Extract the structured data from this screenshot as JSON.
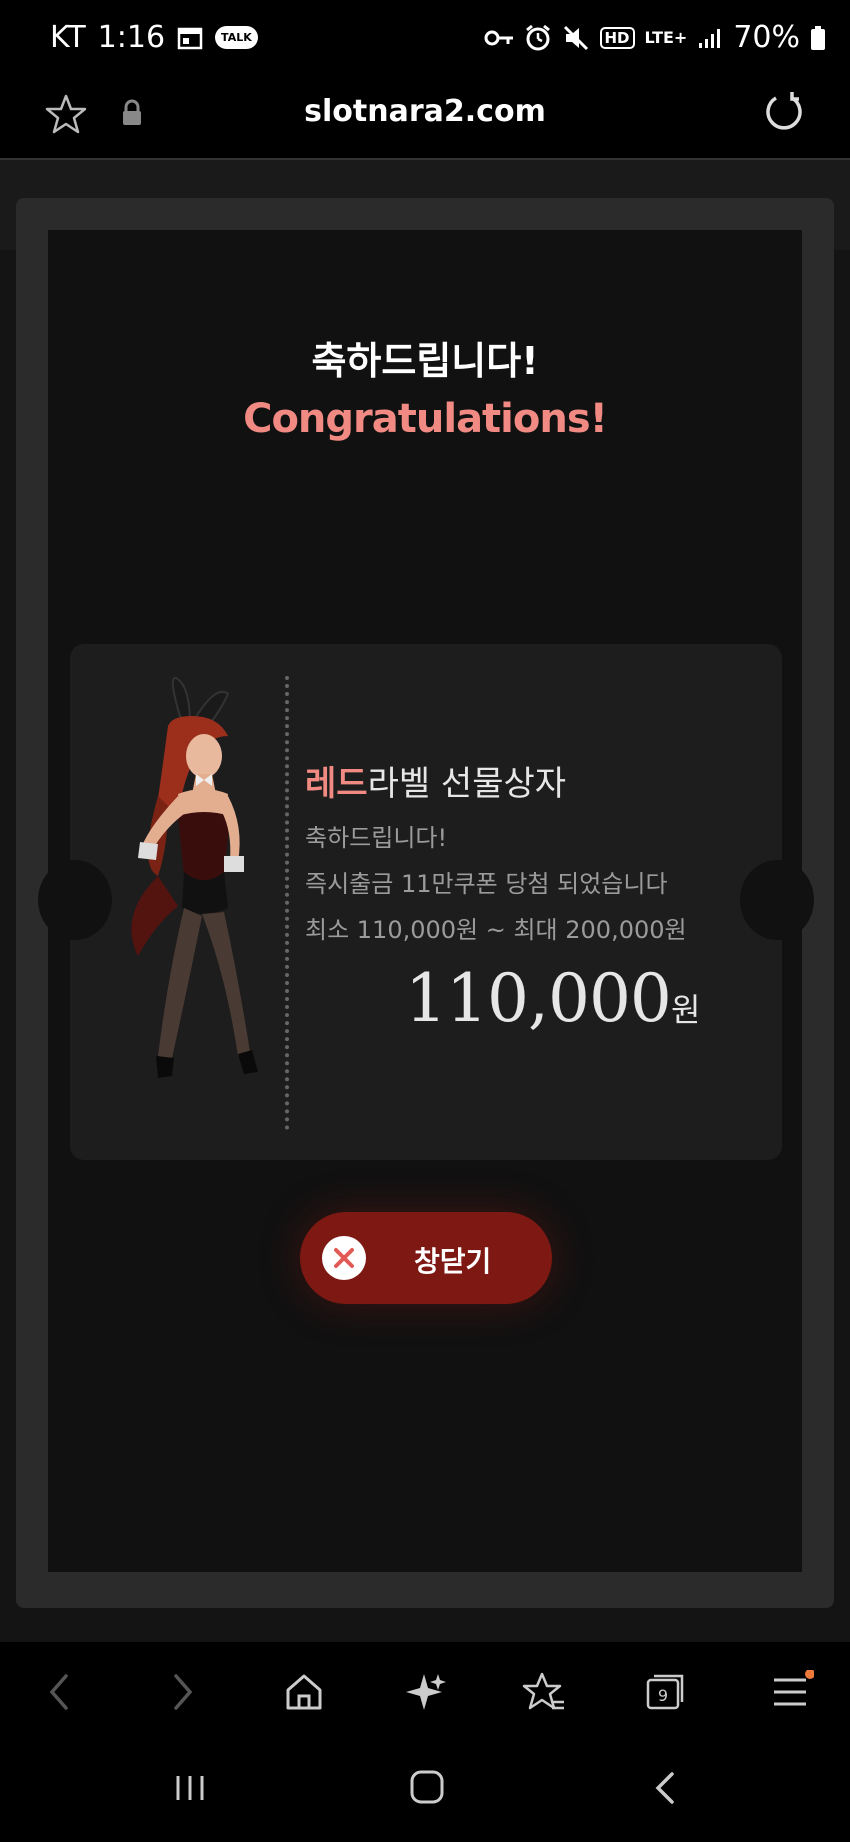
{
  "status_bar": {
    "carrier": "KT",
    "time": "1:16",
    "talk_badge": "TALK",
    "hd": "HD",
    "network": "LTE+",
    "battery": "70%"
  },
  "browser": {
    "url": "slotnara2.com"
  },
  "modal": {
    "title_ko": "축하드립니다!",
    "title_en": "Congratulations!",
    "prize": {
      "title_highlight": "레드",
      "title_rest": "라벨 선물상자",
      "line1": "축하드립니다!",
      "line2": "즉시출금 11만쿠폰 당첨 되었습니다",
      "line3": "최소 110,000원 ~ 최대 200,000원",
      "amount": "110,000",
      "amount_unit": "원"
    },
    "close_label": "창닫기"
  },
  "bottom_bar": {
    "tabs_count": "9"
  },
  "colors": {
    "accent": "#f08a82",
    "button": "#7e1812",
    "notification_dot": "#f07a3c"
  }
}
